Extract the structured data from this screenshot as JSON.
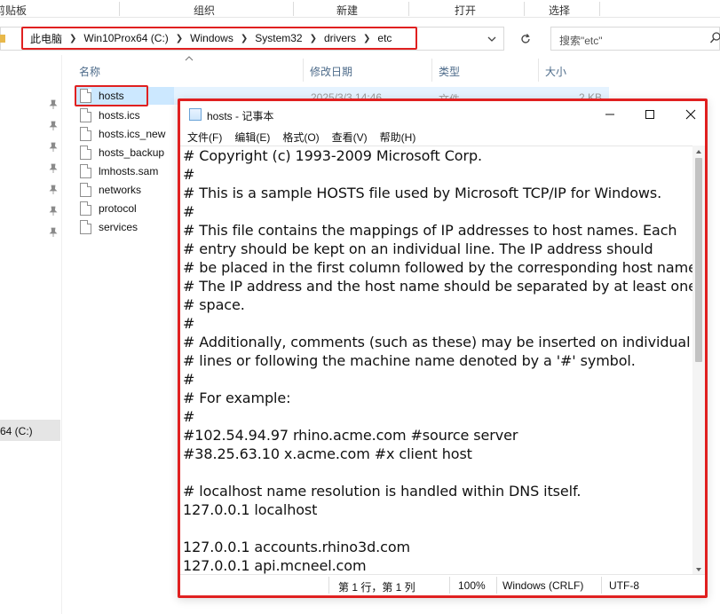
{
  "ribbon": {
    "groups": [
      "剪贴板",
      "组织",
      "新建",
      "打开",
      "选择"
    ]
  },
  "address": {
    "crumbs": [
      "此电脑",
      "Win10Prox64 (C:)",
      "Windows",
      "System32",
      "drivers",
      "etc"
    ],
    "search_placeholder": "搜索\"etc\""
  },
  "icons": {
    "pin": "pin-icon",
    "refresh": "refresh-icon",
    "search": "search-icon",
    "file": "file-icon"
  },
  "nav": {
    "drive_label": "64 (C:)"
  },
  "columns": {
    "name": "名称",
    "modified": "修改日期",
    "type": "类型",
    "size": "大小"
  },
  "files": [
    {
      "name": "hosts",
      "modified": "2025/3/3 14:46",
      "type": "文件",
      "size": "2 KB"
    },
    {
      "name": "hosts.ics"
    },
    {
      "name": "hosts.ics_new"
    },
    {
      "name": "hosts_backup"
    },
    {
      "name": "lmhosts.sam"
    },
    {
      "name": "networks"
    },
    {
      "name": "protocol"
    },
    {
      "name": "services"
    }
  ],
  "notepad": {
    "title": "hosts - 记事本",
    "menu": [
      "文件(F)",
      "编辑(E)",
      "格式(O)",
      "查看(V)",
      "帮助(H)"
    ],
    "lines": [
      "# Copyright (c) 1993-2009 Microsoft Corp.",
      "#",
      "# This is a sample HOSTS file used by Microsoft TCP/IP for Windows.",
      "#",
      "# This file contains the mappings of IP addresses to host names. Each",
      "# entry should be kept on an individual line. The IP address should",
      "# be placed in the first column followed by the corresponding host name.",
      "# The IP address and the host name should be separated by at least one",
      "# space.",
      "#",
      "# Additionally, comments (such as these) may be inserted on individual",
      "# lines or following the machine name denoted by a '#' symbol.",
      "#",
      "# For example:",
      "#",
      "#102.54.94.97 rhino.acme.com #source server",
      "#38.25.63.10 x.acme.com #x client host",
      "",
      "# localhost name resolution is handled within DNS itself.",
      "127.0.0.1 localhost",
      "",
      "127.0.0.1 accounts.rhino3d.com",
      "127.0.0.1 api.mcneel.com"
    ],
    "status": {
      "position": "第 1 行，第 1 列",
      "zoom": "100%",
      "line_ending": "Windows (CRLF)",
      "encoding": "UTF-8"
    }
  },
  "colors": {
    "highlight_border": "#e02020",
    "selection": "#cce8ff"
  }
}
